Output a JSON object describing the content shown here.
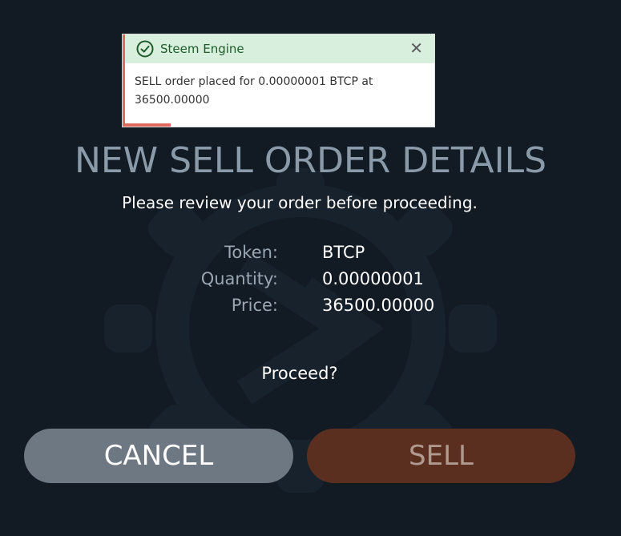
{
  "toast": {
    "title": "Steem Engine",
    "close_glyph": "✕",
    "message": "SELL order placed for 0.00000001 BTCP at 36500.00000",
    "icon": "check-circle-icon"
  },
  "dialog": {
    "title": "NEW SELL ORDER DETAILS",
    "subtitle": "Please review your order before proceeding.",
    "rows": [
      {
        "label": "Token:",
        "value": "BTCP"
      },
      {
        "label": "Quantity:",
        "value": "0.00000001"
      },
      {
        "label": "Price:",
        "value": "36500.00000"
      }
    ],
    "prompt": "Proceed?"
  },
  "buttons": {
    "cancel_label": "CANCEL",
    "sell_label": "SELL"
  },
  "colors": {
    "background": "#121b24",
    "toast_header": "#d7efdc",
    "toast_accent": "#e06a5f",
    "cancel_button": "#6e7882",
    "sell_button": "#5b2f1f"
  }
}
